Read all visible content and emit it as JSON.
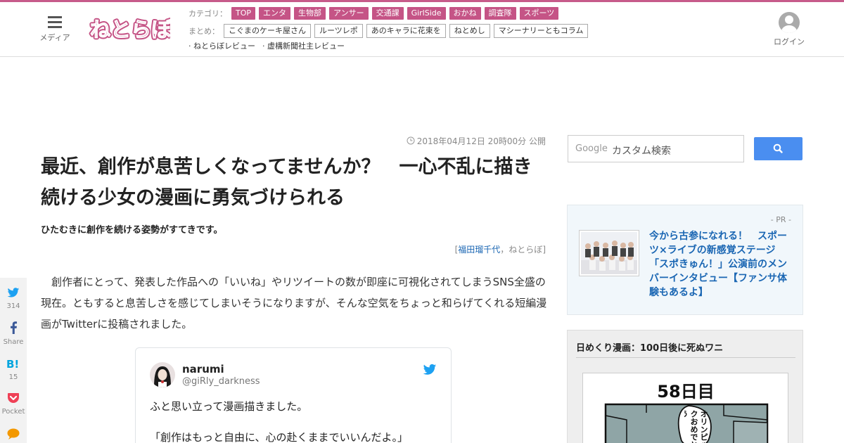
{
  "header": {
    "menu_label": "メディア",
    "logo_text": "ねとらぼ",
    "category_label": "カテゴリ：",
    "categories": [
      "TOP",
      "エンタ",
      "生物部",
      "アンサー",
      "交通課",
      "GirlSide",
      "おかね",
      "調査隊",
      "スポーツ"
    ],
    "summary_label": "まとめ：",
    "summaries": [
      "こぐまのケーキ屋さん",
      "ルーツレポ",
      "あのキャラに花束を",
      "ねとめし",
      "マシーナリーともコラム"
    ],
    "reviews": [
      "· ねとらぼレビュー",
      "· 虚構新聞社主レビュー"
    ],
    "login_label": "ログイン"
  },
  "article": {
    "date": "2018年04月12日 20時00分 公開",
    "title": "最近、創作が息苦しくなってませんか？　一心不乱に描き続ける少女の漫画に勇気づけられる",
    "subtitle": "ひたむきに創作を続ける姿勢がすてきです。",
    "byline_open": "[",
    "author": "福田瑠千代",
    "byline_sep": "，",
    "publisher": "ねとらぼ",
    "byline_close": "]",
    "body": "　創作者にとって、発表した作品への「いいね」やリツイートの数が即座に可視化されてしまうSNS全盛の現在。ともすると息苦しさを感じてしまいそうになりますが、そんな空気をちょっと和らげてくれる短編漫画がTwitterに投稿されました。"
  },
  "tweet": {
    "name": "narumi",
    "handle": "@giRly_darkness",
    "line1": "ふと思い立って漫画描きました。",
    "line2": "「創作はもっと自由に、心の赴くままでいいんだよ。」"
  },
  "share": [
    {
      "icon": "twitter-icon",
      "count": "314"
    },
    {
      "icon": "facebook-icon",
      "count": "Share"
    },
    {
      "icon": "hatena-bookmark-icon",
      "count": "15"
    },
    {
      "icon": "pocket-icon",
      "count": "Pocket"
    },
    {
      "icon": "comment-icon",
      "count": ""
    }
  ],
  "sidebar": {
    "search_brand": "Google",
    "search_placeholder": "カスタム検索",
    "pr_label": "- PR -",
    "pr_text": "今から古参になれる！　スポーツ×ライブの新感覚ステージ「スポきゅん！」公演前のメンバーインタビュー【ファンサ体験もあるよ】",
    "manga_title": "日めくり漫画：100日後に死ぬワニ",
    "manga_day": "58日目",
    "manga_bubble": "オリンピックおめでとう"
  },
  "colors": {
    "accent": "#c55486",
    "link": "#1a66b3",
    "search_button": "#4a8ef0",
    "twitter": "#1da1f2"
  }
}
